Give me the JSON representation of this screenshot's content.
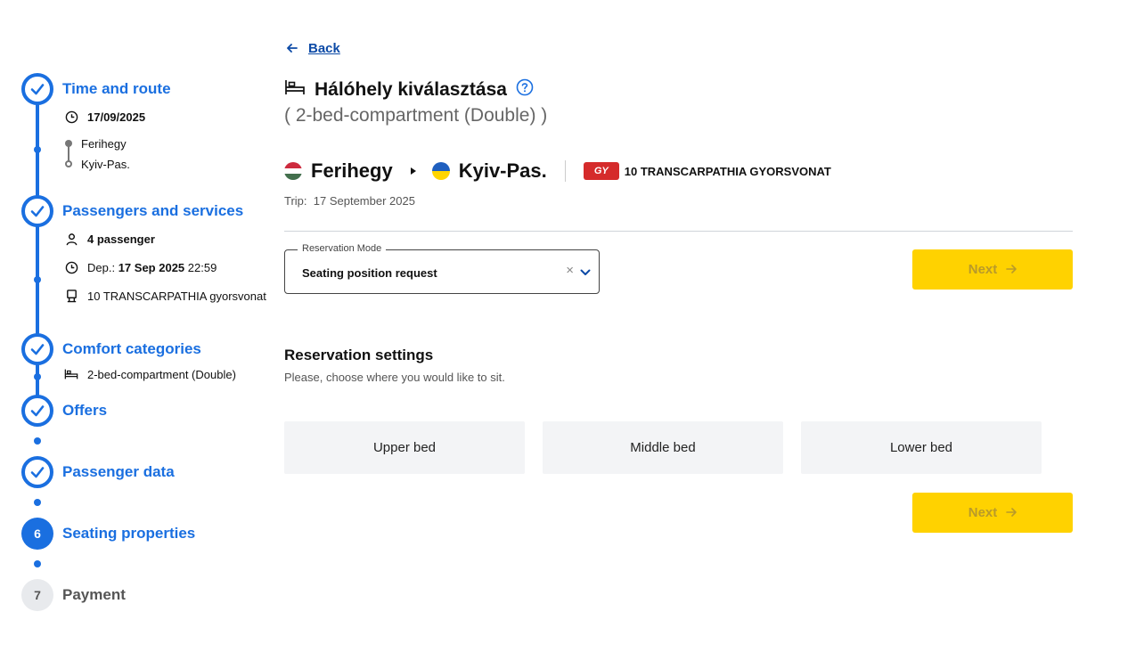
{
  "stepper": {
    "steps": [
      {
        "label": "Time and route",
        "state": "done"
      },
      {
        "label": "Passengers and services",
        "state": "done"
      },
      {
        "label": "Comfort categories",
        "state": "done"
      },
      {
        "label": "Offers",
        "state": "done"
      },
      {
        "label": "Passenger data",
        "state": "done"
      },
      {
        "label": "Seating properties",
        "state": "current",
        "number": "6"
      },
      {
        "label": "Payment",
        "state": "future",
        "number": "7"
      }
    ],
    "time_route": {
      "date": "17/09/2025",
      "from": "Ferihegy",
      "to": "Kyiv-Pas."
    },
    "passengers": {
      "count": "4 passenger",
      "dep_prefix": "Dep.:",
      "dep_date": "17 Sep 2025",
      "dep_time": "22:59",
      "train": "10 TRANSCARPATHIA gyorsvonat"
    },
    "comfort": {
      "category": "2-bed-compartment (Double)"
    }
  },
  "main": {
    "back_label": "Back",
    "title": "Hálóhely kiválasztása",
    "subtitle": "( 2-bed-compartment (Double) )",
    "route": {
      "from": "Ferihegy",
      "to": "Kyiv-Pas.",
      "train_badge": "GY",
      "train_name": "10 TRANSCARPATHIA GYORSVONAT"
    },
    "trip_label": "Trip:",
    "trip_date": "17 September 2025",
    "reservation_mode": {
      "legend": "Reservation Mode",
      "value": "Seating position request"
    },
    "next_label": "Next",
    "settings_title": "Reservation settings",
    "settings_subtitle": "Please, choose where you would like to sit.",
    "beds": [
      "Upper bed",
      "Middle bed",
      "Lower bed"
    ]
  },
  "colors": {
    "accent": "#1a6fe0",
    "next_button": "#ffd200",
    "badge": "#d52b2b"
  }
}
